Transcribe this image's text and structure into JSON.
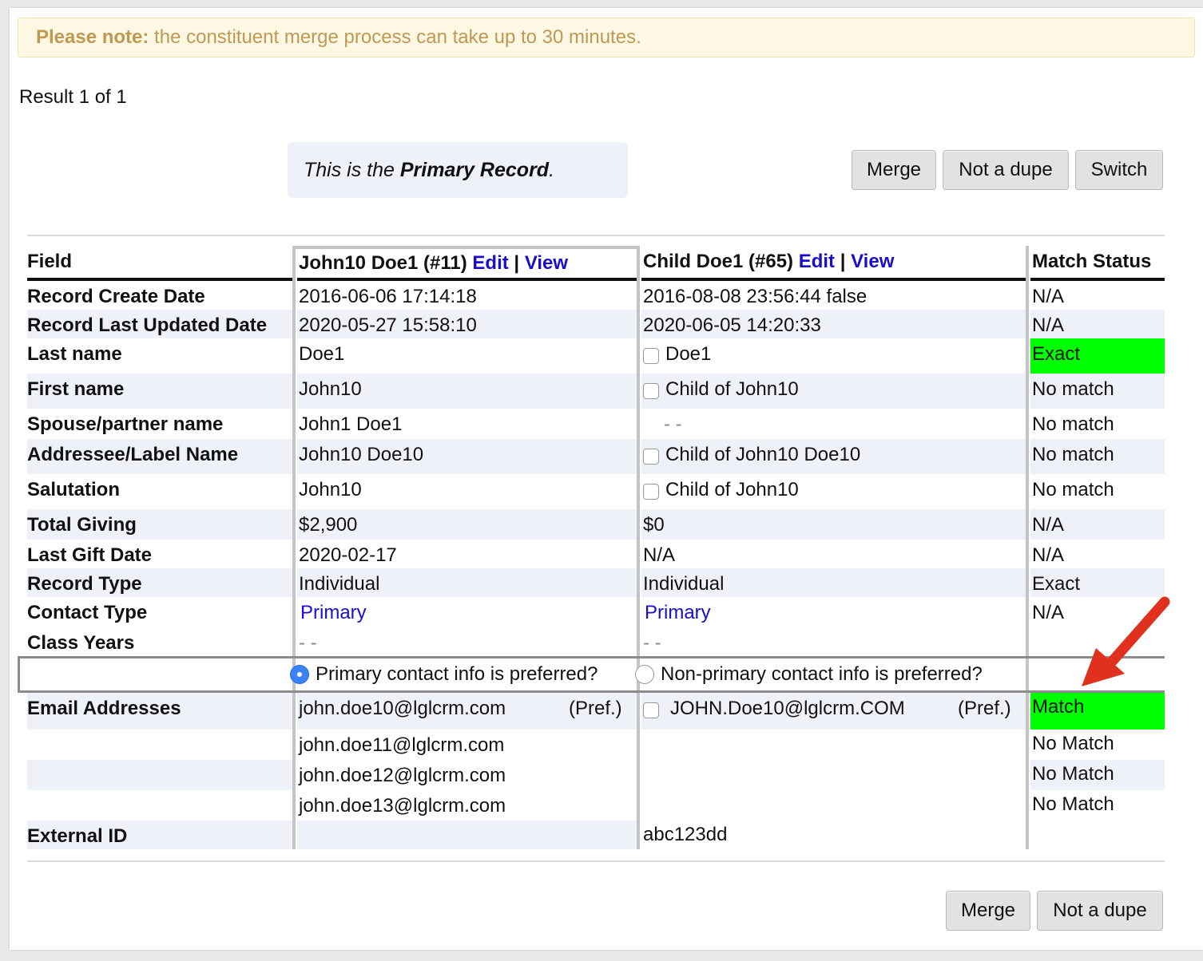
{
  "notice": {
    "bold": "Please note:",
    "text": " the constituent merge process can take up to 30 minutes."
  },
  "result": "Result 1 of 1",
  "primary_box": {
    "prefix": "This is the ",
    "bold": "Primary Record",
    "suffix": "."
  },
  "top_buttons": {
    "merge": "Merge",
    "not_dupe": "Not a dupe",
    "switch": "Switch"
  },
  "bottom_buttons": {
    "merge": "Merge",
    "not_dupe": "Not a dupe"
  },
  "header": {
    "field": "Field",
    "primary_name": "John10 Doe1 (#11)",
    "secondary_name": "Child Doe1 (#65)",
    "edit": "Edit",
    "sep": "|",
    "view": "View",
    "match": "Match Status"
  },
  "rows": [
    {
      "field": "Record Create Date",
      "primary": "2016-06-06 17:14:18",
      "secondary": "2016-08-08 23:56:44 false",
      "match": "N/A"
    },
    {
      "field": "Record Last Updated Date",
      "primary": "2020-05-27 15:58:10",
      "secondary": "2020-06-05 14:20:33",
      "match": "N/A"
    },
    {
      "field": "Last name",
      "primary": "Doe1",
      "secondary": "Doe1",
      "match": "Exact"
    },
    {
      "field": "First name",
      "primary": "John10",
      "secondary": "Child of John10",
      "match": "No match"
    },
    {
      "field": "Spouse/partner name",
      "primary": "John1 Doe1",
      "secondary": "- -",
      "match": "No match"
    },
    {
      "field": "Addressee/Label Name",
      "primary": "John10 Doe10",
      "secondary": "Child of John10 Doe10",
      "match": "No match"
    },
    {
      "field": "Salutation",
      "primary": "John10",
      "secondary": "Child of John10",
      "match": "No match"
    },
    {
      "field": "Total Giving",
      "primary": "$2,900",
      "secondary": "$0",
      "match": "N/A"
    },
    {
      "field": "Last Gift Date",
      "primary": "2020-02-17",
      "secondary": "N/A",
      "match": "N/A"
    },
    {
      "field": "Record Type",
      "primary": "Individual",
      "secondary": "Individual",
      "match": "Exact"
    },
    {
      "field": "Contact Type",
      "primary": "Primary",
      "secondary": "Primary",
      "match": "N/A"
    },
    {
      "field": "Class Years",
      "primary": "- -",
      "secondary": "- -",
      "match": ""
    }
  ],
  "contact_pref": {
    "primary_label": "Primary contact info is preferred?",
    "secondary_label": "Non-primary contact info is preferred?"
  },
  "emails": {
    "field": "Email Addresses",
    "pref_label": "(Pref.)",
    "primary": [
      "john.doe10@lglcrm.com",
      "john.doe11@lglcrm.com",
      "john.doe12@lglcrm.com",
      "john.doe13@lglcrm.com"
    ],
    "secondary": "JOHN.Doe10@lglcrm.COM",
    "match": [
      "Match",
      "No Match",
      "No Match",
      "No Match"
    ]
  },
  "external_id": {
    "field": "External ID",
    "primary": "",
    "secondary": "abc123dd",
    "match": ""
  },
  "colors": {
    "match_green": "#00ff00",
    "link_blue": "#1a0dcc",
    "arrow_red": "#e0301e",
    "notice_text": "#c09853"
  }
}
